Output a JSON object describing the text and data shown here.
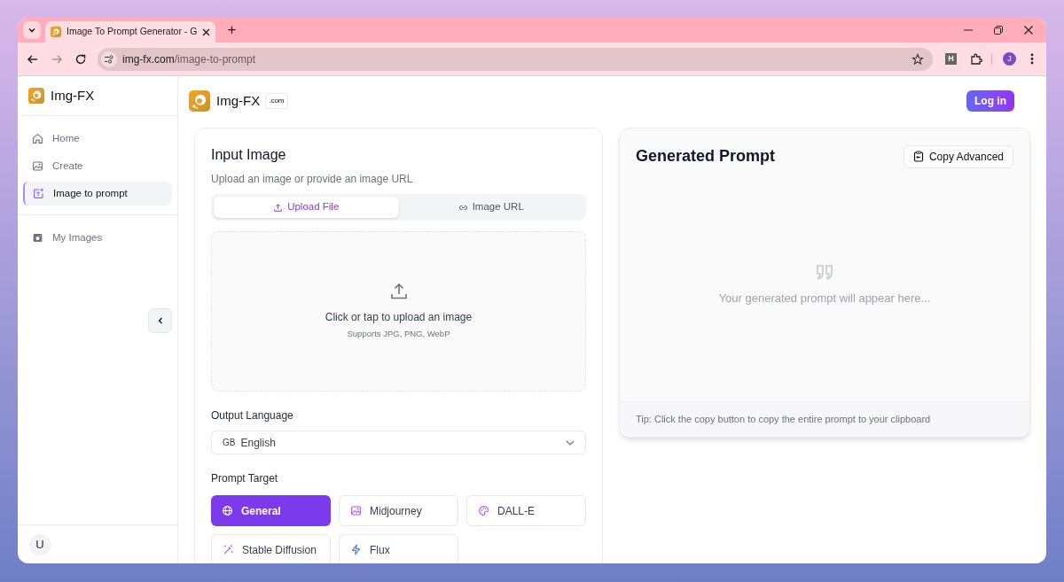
{
  "browser": {
    "tabs": [
      {
        "title": "Image To Prompt Generator - G",
        "selected": true
      }
    ],
    "new_tab": "+",
    "address_host": "img-fx.com",
    "address_path": "/image-to-prompt",
    "extension_badge": "H",
    "profile_initial": "J"
  },
  "sidebar": {
    "brand": "Img-FX",
    "items": [
      {
        "label": "Home",
        "kind": "home",
        "selected": false
      },
      {
        "label": "Create",
        "kind": "picture",
        "selected": false
      },
      {
        "label": "Image to prompt",
        "kind": "text-image",
        "selected": true
      }
    ],
    "secondary_items": [
      {
        "label": "My Images",
        "kind": "camera",
        "selected": false
      }
    ],
    "user_initial": "U"
  },
  "header": {
    "brand": "Img-FX",
    "domain_badge": ".com",
    "login_button": "Log in"
  },
  "input_card": {
    "title": "Input Image",
    "subtitle": "Upload an image or provide an image URL",
    "tabs": [
      {
        "label": "Upload File",
        "kind": "upload",
        "selected": true
      },
      {
        "label": "Image URL",
        "kind": "link",
        "selected": false
      }
    ],
    "dropzone": {
      "title": "Click or tap to upload an image",
      "hint": "Supports JPG, PNG, WebP"
    },
    "language": {
      "label": "Output Language",
      "flag": "GB",
      "value": "English"
    },
    "prompt_target": {
      "label": "Prompt Target",
      "options": [
        {
          "label": "General",
          "kind": "globe",
          "selected": true
        },
        {
          "label": "Midjourney",
          "kind": "picture",
          "selected": false
        },
        {
          "label": "DALL-E",
          "kind": "palette",
          "selected": false
        },
        {
          "label": "Stable Diffusion",
          "kind": "wand",
          "selected": false
        },
        {
          "label": "Flux",
          "kind": "bolt",
          "selected": false
        }
      ]
    }
  },
  "output_card": {
    "title": "Generated Prompt",
    "copy_button": "Copy Advanced",
    "placeholder": "Your generated prompt will appear here...",
    "tip": "Tip: Click the copy button to copy the entire prompt to your clipboard"
  }
}
